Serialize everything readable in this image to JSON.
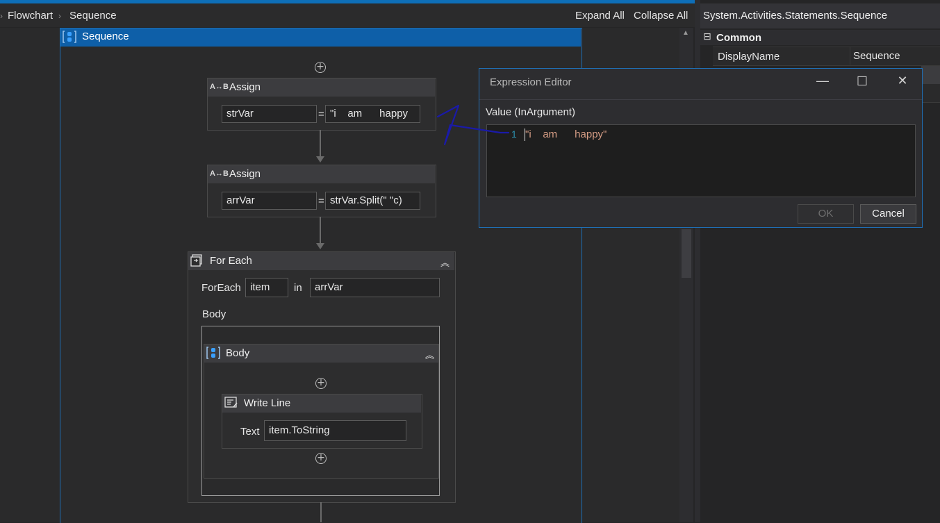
{
  "breadcrumb": {
    "items": [
      "Flowchart",
      "Sequence"
    ]
  },
  "toolbar": {
    "expand_all": "Expand All",
    "collapse_all": "Collapse All"
  },
  "sequence": {
    "title": "Sequence"
  },
  "assign1": {
    "title": "Assign",
    "to": "strVar",
    "eq": "=",
    "value": "\"i    am      happy"
  },
  "assign2": {
    "title": "Assign",
    "to": "arrVar",
    "eq": "=",
    "value": "strVar.Split(\" \"c)"
  },
  "foreach": {
    "title": "For Each",
    "foreach_label": "ForEach",
    "item": "item",
    "in_label": "in",
    "collection": "arrVar",
    "body_label": "Body",
    "body_seq_title": "Body"
  },
  "writeline": {
    "title": "Write Line",
    "text_label": "Text",
    "text_value": "item.ToString"
  },
  "properties": {
    "type_name": "System.Activities.Statements.Sequence",
    "category": "Common",
    "collapse_glyph": "⊟",
    "rows": [
      {
        "name": "DisplayName",
        "value": "Sequence"
      }
    ]
  },
  "dialog": {
    "title": "Expression Editor",
    "label": "Value (InArgument)",
    "line_number": "1",
    "code": "\"i    am      happy\"",
    "ok": "OK",
    "cancel": "Cancel"
  },
  "colors": {
    "accent": "#0e6fb8",
    "string_literal": "#d69d85",
    "annotation_ink": "#1a1aa8"
  }
}
